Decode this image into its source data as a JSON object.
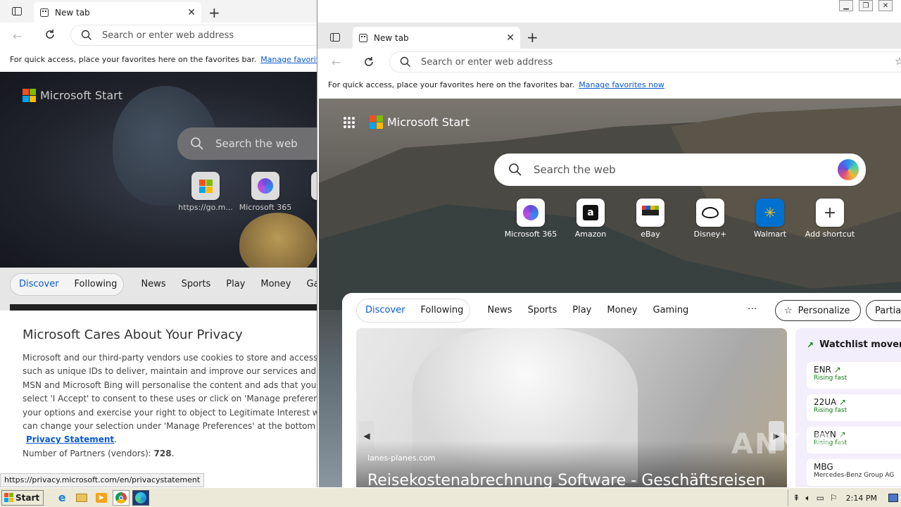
{
  "back": {
    "tab_title": "New tab",
    "address_placeholder": "Search or enter web address",
    "fav_text": "For quick access, place your favorites here on the favorites bar.",
    "fav_link": "Manage favorites n",
    "brand": "Microsoft Start",
    "search_placeholder": "Search the web",
    "shortcuts": [
      "https://go.m...",
      "Microsoft 365",
      "A"
    ],
    "nav": [
      "Discover",
      "Following",
      "News",
      "Sports",
      "Play",
      "Money",
      "Ga"
    ],
    "privacy_title": "Microsoft Cares About Your Privacy",
    "privacy_lines": [
      "Microsoft and our third-party vendors use cookies to store and access",
      "such as unique IDs to deliver, maintain and improve our services and ac",
      "MSN and Microsoft Bing will personalise the content and ads that you s",
      "select 'I Accept' to consent to these uses or click on 'Manage preference",
      "your options and exercise your right to object to Legitimate Interest wh",
      "can change your selection under 'Manage Preferences' at the bottom of"
    ],
    "privacy_link": "Privacy Statement",
    "partners_label": "Number of Partners (vendors):",
    "partners_count": "728",
    "status_url": "https://privacy.microsoft.com/en/privacystatement"
  },
  "front": {
    "tab_title": "New tab",
    "address_placeholder": "Search or enter web address",
    "fav_text": "For quick access, place your favorites here on the favorites bar.",
    "fav_link": "Manage favorites now",
    "brand": "Microsoft Start",
    "search_placeholder": "Search the web",
    "shortcuts": [
      {
        "label": "Microsoft 365",
        "icon": "microsoft-365-icon"
      },
      {
        "label": "Amazon",
        "icon": "amazon-icon"
      },
      {
        "label": "eBay",
        "icon": "ebay-icon"
      },
      {
        "label": "Disney+",
        "icon": "disney-plus-icon"
      },
      {
        "label": "Walmart",
        "icon": "walmart-icon"
      },
      {
        "label": "Add shortcut",
        "icon": "plus-icon"
      }
    ],
    "nav": [
      "Discover",
      "Following",
      "News",
      "Sports",
      "Play",
      "Money",
      "Gaming"
    ],
    "more": "···",
    "personalize": "Personalize",
    "partial": "Partial",
    "article_source": "lanes-planes.com",
    "article_title": "Reisekostenabrechnung Software - Geschäftsreisen",
    "watchlist_title": "Watchlist movers",
    "watchlist": [
      {
        "ticker": "ENR",
        "status": "Rising fast"
      },
      {
        "ticker": "22UA",
        "status": "Rising fast"
      },
      {
        "ticker": "BAYN",
        "status": "Rising fast"
      },
      {
        "ticker": "MBG",
        "status": "Mercedes-Benz Group AG"
      }
    ],
    "watermark": "ANY RUN"
  },
  "taskbar": {
    "start": "Start",
    "clock": "2:14 PM"
  },
  "colors": {
    "accent": "#0b59d0",
    "rising": "#107c10",
    "taskbar": "#ece9d8"
  }
}
